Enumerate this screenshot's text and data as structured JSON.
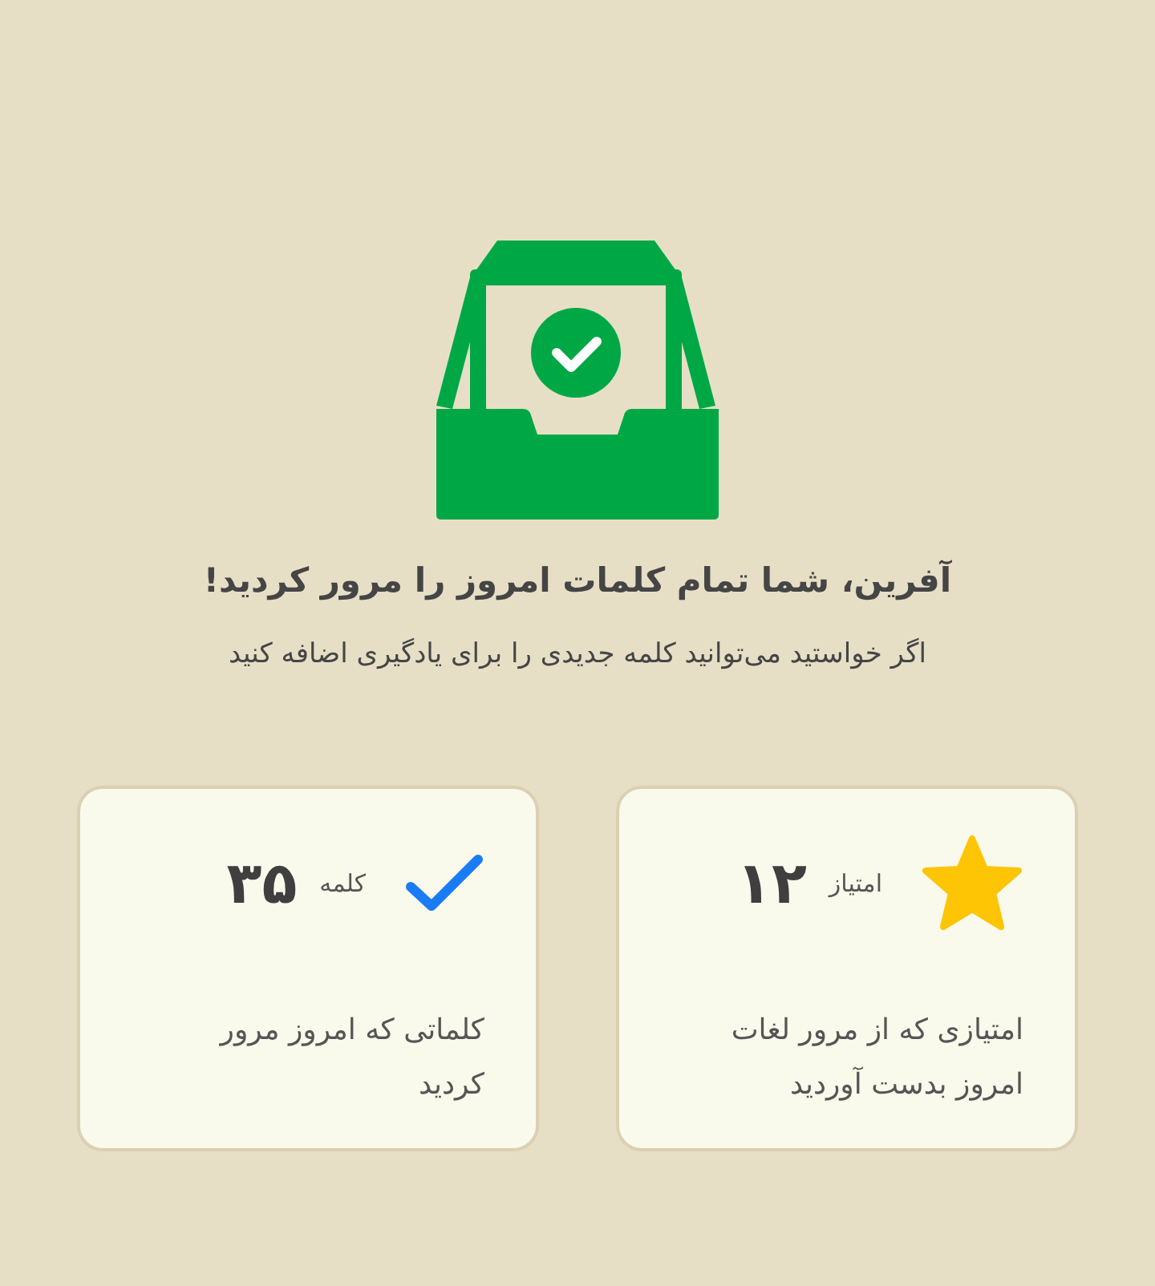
{
  "title": "آفرین، شما تمام کلمات امروز را مرور کردید!",
  "subtitle": "اگر خواستید می‌توانید کلمه جدیدی را برای یادگیری اضافه کنید",
  "cards": [
    {
      "kind": "points",
      "value": "۱۲",
      "label": "امتیاز",
      "description": "امتیازی که از مرور لغات امروز بدست آوردید"
    },
    {
      "kind": "words",
      "value": "۳۵",
      "label": "کلمه",
      "description": "کلماتی که امروز مرور کردید"
    }
  ]
}
